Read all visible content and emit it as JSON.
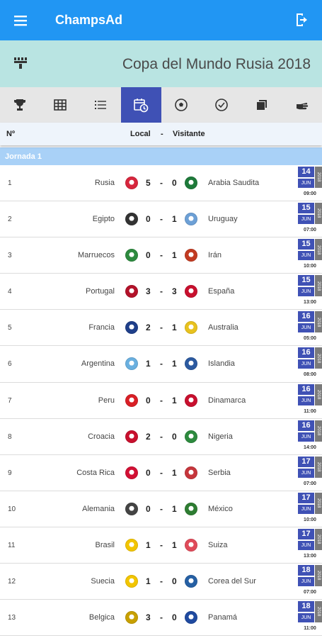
{
  "app": {
    "title": "ChampsAd"
  },
  "banner": {
    "competition": "Copa del Mundo Rusia 2018"
  },
  "tabs": [
    {
      "icon": "trophy-icon"
    },
    {
      "icon": "grid-icon"
    },
    {
      "icon": "list-icon"
    },
    {
      "icon": "calendar-clock-icon",
      "active": true
    },
    {
      "icon": "soccer-ball-icon"
    },
    {
      "icon": "check-circle-icon"
    },
    {
      "icon": "copy-icon"
    },
    {
      "icon": "hand-pointing-icon"
    }
  ],
  "columns": {
    "num": "Nº",
    "local": "Local",
    "sep": "-",
    "visitor": "Visitante"
  },
  "round": {
    "label": "Jornada 1"
  },
  "matches": [
    {
      "num": "1",
      "home": "Rusia",
      "hg": "5",
      "ag": "0",
      "away": "Arabia Saudita",
      "day": "14",
      "month": "JUN",
      "year": "2018",
      "time": "09:00",
      "hcolor": "#d7263d",
      "acolor": "#1e7a3a"
    },
    {
      "num": "2",
      "home": "Egipto",
      "hg": "0",
      "ag": "1",
      "away": "Uruguay",
      "day": "15",
      "month": "JUN",
      "year": "2018",
      "time": "07:00",
      "hcolor": "#333333",
      "acolor": "#6da0d6"
    },
    {
      "num": "3",
      "home": "Marruecos",
      "hg": "0",
      "ag": "1",
      "away": "Irán",
      "day": "15",
      "month": "JUN",
      "year": "2018",
      "time": "10:00",
      "hcolor": "#2d8a3e",
      "acolor": "#c23b22"
    },
    {
      "num": "4",
      "home": "Portugal",
      "hg": "3",
      "ag": "3",
      "away": "España",
      "day": "15",
      "month": "JUN",
      "year": "2018",
      "time": "13:00",
      "hcolor": "#b3122a",
      "acolor": "#c8102e"
    },
    {
      "num": "5",
      "home": "Francia",
      "hg": "2",
      "ag": "1",
      "away": "Australia",
      "day": "16",
      "month": "JUN",
      "year": "2018",
      "time": "05:00",
      "hcolor": "#1f3f8a",
      "acolor": "#e8c21f"
    },
    {
      "num": "6",
      "home": "Argentina",
      "hg": "1",
      "ag": "1",
      "away": "Islandia",
      "day": "16",
      "month": "JUN",
      "year": "2018",
      "time": "08:00",
      "hcolor": "#6ab0e0",
      "acolor": "#2c5aa0"
    },
    {
      "num": "7",
      "home": "Peru",
      "hg": "0",
      "ag": "1",
      "away": "Dinamarca",
      "day": "16",
      "month": "JUN",
      "year": "2018",
      "time": "11:00",
      "hcolor": "#d91f26",
      "acolor": "#c8102e"
    },
    {
      "num": "8",
      "home": "Croacia",
      "hg": "2",
      "ag": "0",
      "away": "Nigeria",
      "day": "16",
      "month": "JUN",
      "year": "2018",
      "time": "14:00",
      "hcolor": "#c8102e",
      "acolor": "#2d8a3e"
    },
    {
      "num": "9",
      "home": "Costa Rica",
      "hg": "0",
      "ag": "1",
      "away": "Serbia",
      "day": "17",
      "month": "JUN",
      "year": "2018",
      "time": "07:00",
      "hcolor": "#d21034",
      "acolor": "#c6363c"
    },
    {
      "num": "10",
      "home": "Alemania",
      "hg": "0",
      "ag": "1",
      "away": "México",
      "day": "17",
      "month": "JUN",
      "year": "2018",
      "time": "10:00",
      "hcolor": "#444444",
      "acolor": "#2e7d32"
    },
    {
      "num": "11",
      "home": "Brasil",
      "hg": "1",
      "ag": "1",
      "away": "Suiza",
      "day": "17",
      "month": "JUN",
      "year": "2018",
      "time": "13:00",
      "hcolor": "#f2c500",
      "acolor": "#e04b5a"
    },
    {
      "num": "12",
      "home": "Suecia",
      "hg": "1",
      "ag": "0",
      "away": "Corea del Sur",
      "day": "18",
      "month": "JUN",
      "year": "2018",
      "time": "07:00",
      "hcolor": "#f2c500",
      "acolor": "#2660a4"
    },
    {
      "num": "13",
      "home": "Belgica",
      "hg": "3",
      "ag": "0",
      "away": "Panamá",
      "day": "18",
      "month": "JUN",
      "year": "2018",
      "time": "11:00",
      "hcolor": "#c8a000",
      "acolor": "#1f4aa0"
    }
  ]
}
